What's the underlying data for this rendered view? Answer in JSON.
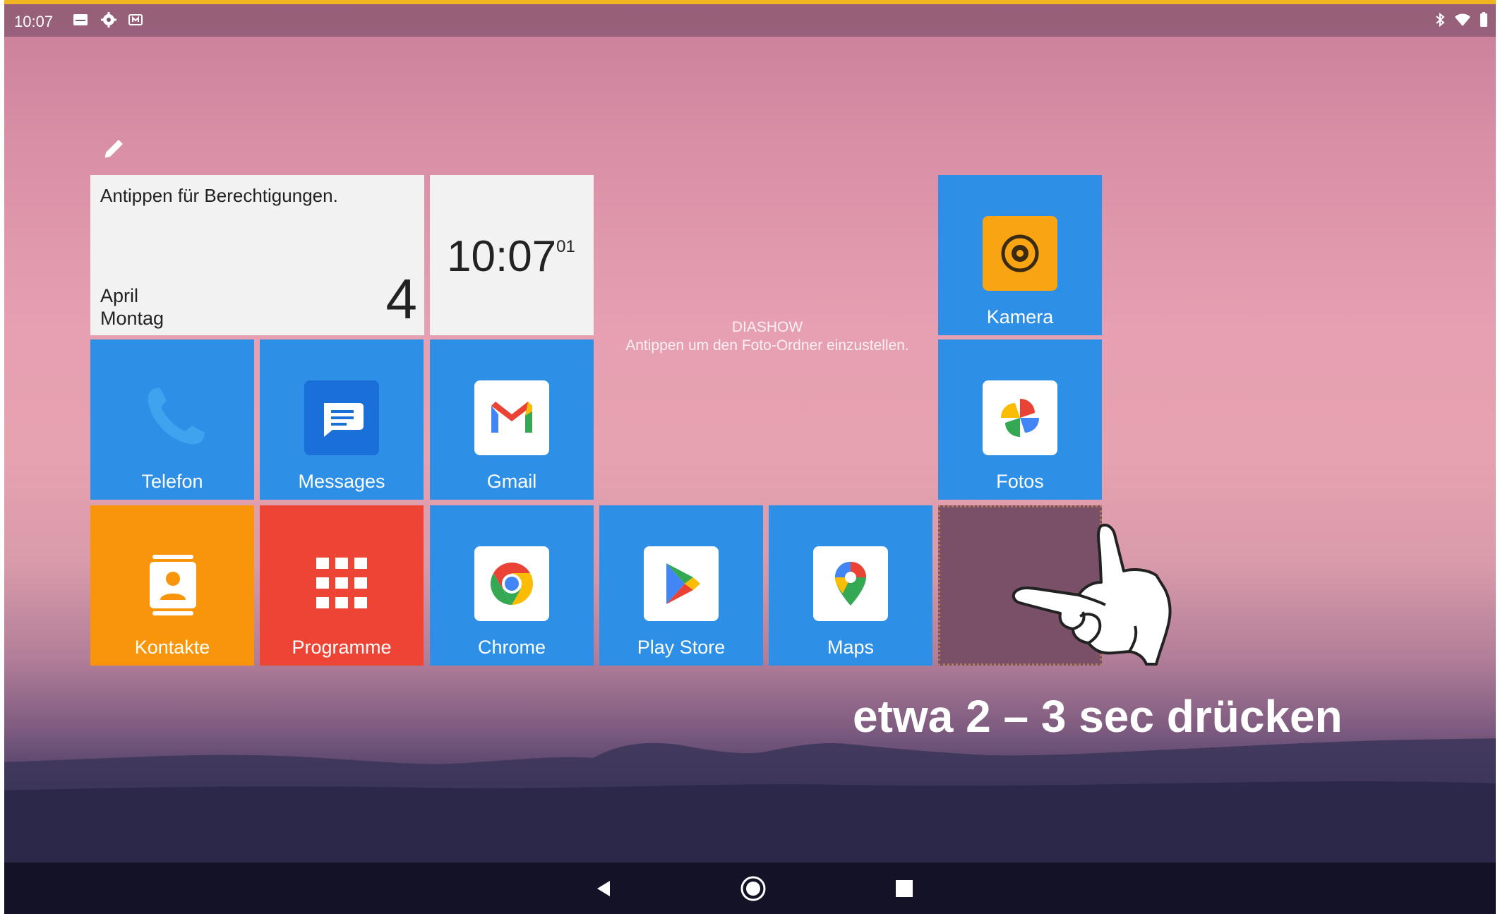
{
  "status_bar": {
    "time": "10:07",
    "left_icons": [
      "image-icon",
      "gear-icon",
      "cast-icon"
    ],
    "right_icons": [
      "bluetooth-icon",
      "wifi-icon",
      "battery-icon"
    ]
  },
  "calendar_widget": {
    "permission_text": "Antippen für Berechtigungen.",
    "month": "April",
    "weekday": "Montag",
    "day": "4"
  },
  "clock_widget": {
    "time": "10:07",
    "seconds": "01"
  },
  "slideshow_widget": {
    "title": "DIASHOW",
    "hint": "Antippen um den Foto-Ordner einzustellen."
  },
  "apps": {
    "kamera": "Kamera",
    "fotos": "Fotos",
    "telefon": "Telefon",
    "messages": "Messages",
    "gmail": "Gmail",
    "kontakte": "Kontakte",
    "programme": "Programme",
    "chrome": "Chrome",
    "play_store": "Play Store",
    "maps": "Maps"
  },
  "instruction": "etwa 2 – 3 sec drücken",
  "colors": {
    "tile_blue": "#2e8fe6",
    "tile_orange": "#f9950a",
    "tile_red": "#ee4436",
    "empty_tile": "#7a4f68",
    "top_accent": "#f0b520"
  }
}
